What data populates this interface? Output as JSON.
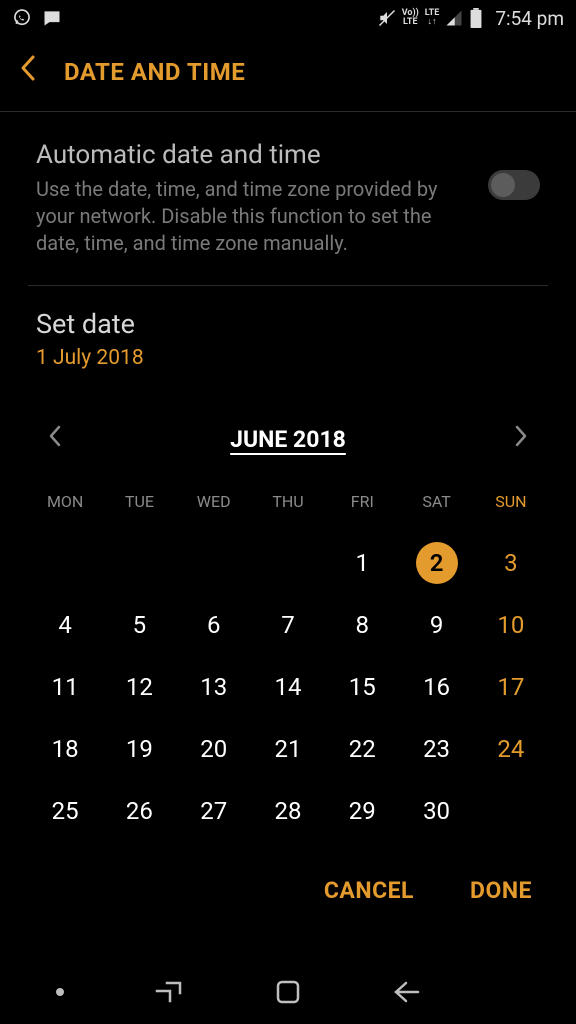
{
  "status": {
    "time": "7:54 pm"
  },
  "header": {
    "title": "DATE AND TIME"
  },
  "auto": {
    "title": "Automatic date and time",
    "description": "Use the date, time, and time zone provided by your network. Disable this function to set the date, time, and time zone manually.",
    "enabled": false
  },
  "setdate": {
    "title": "Set date",
    "value": "1 July 2018"
  },
  "calendar": {
    "month_label": "JUNE 2018",
    "dow": [
      "MON",
      "TUE",
      "WED",
      "THU",
      "FRI",
      "SAT",
      "SUN"
    ],
    "leading_blanks": 4,
    "days_in_month": 30,
    "selected_day": 2,
    "weekend_column_index": 6
  },
  "actions": {
    "cancel": "CANCEL",
    "done": "DONE"
  }
}
